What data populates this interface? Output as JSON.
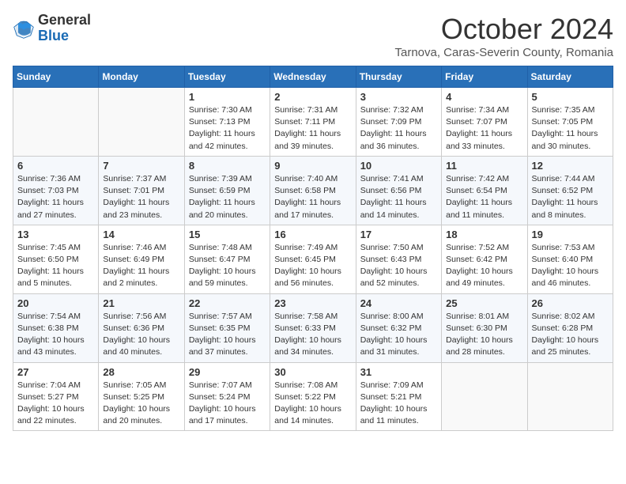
{
  "header": {
    "logo_general": "General",
    "logo_blue": "Blue",
    "month_title": "October 2024",
    "subtitle": "Tarnova, Caras-Severin County, Romania"
  },
  "days_of_week": [
    "Sunday",
    "Monday",
    "Tuesday",
    "Wednesday",
    "Thursday",
    "Friday",
    "Saturday"
  ],
  "weeks": [
    [
      {
        "day": "",
        "info": ""
      },
      {
        "day": "",
        "info": ""
      },
      {
        "day": "1",
        "info": "Sunrise: 7:30 AM\nSunset: 7:13 PM\nDaylight: 11 hours and 42 minutes."
      },
      {
        "day": "2",
        "info": "Sunrise: 7:31 AM\nSunset: 7:11 PM\nDaylight: 11 hours and 39 minutes."
      },
      {
        "day": "3",
        "info": "Sunrise: 7:32 AM\nSunset: 7:09 PM\nDaylight: 11 hours and 36 minutes."
      },
      {
        "day": "4",
        "info": "Sunrise: 7:34 AM\nSunset: 7:07 PM\nDaylight: 11 hours and 33 minutes."
      },
      {
        "day": "5",
        "info": "Sunrise: 7:35 AM\nSunset: 7:05 PM\nDaylight: 11 hours and 30 minutes."
      }
    ],
    [
      {
        "day": "6",
        "info": "Sunrise: 7:36 AM\nSunset: 7:03 PM\nDaylight: 11 hours and 27 minutes."
      },
      {
        "day": "7",
        "info": "Sunrise: 7:37 AM\nSunset: 7:01 PM\nDaylight: 11 hours and 23 minutes."
      },
      {
        "day": "8",
        "info": "Sunrise: 7:39 AM\nSunset: 6:59 PM\nDaylight: 11 hours and 20 minutes."
      },
      {
        "day": "9",
        "info": "Sunrise: 7:40 AM\nSunset: 6:58 PM\nDaylight: 11 hours and 17 minutes."
      },
      {
        "day": "10",
        "info": "Sunrise: 7:41 AM\nSunset: 6:56 PM\nDaylight: 11 hours and 14 minutes."
      },
      {
        "day": "11",
        "info": "Sunrise: 7:42 AM\nSunset: 6:54 PM\nDaylight: 11 hours and 11 minutes."
      },
      {
        "day": "12",
        "info": "Sunrise: 7:44 AM\nSunset: 6:52 PM\nDaylight: 11 hours and 8 minutes."
      }
    ],
    [
      {
        "day": "13",
        "info": "Sunrise: 7:45 AM\nSunset: 6:50 PM\nDaylight: 11 hours and 5 minutes."
      },
      {
        "day": "14",
        "info": "Sunrise: 7:46 AM\nSunset: 6:49 PM\nDaylight: 11 hours and 2 minutes."
      },
      {
        "day": "15",
        "info": "Sunrise: 7:48 AM\nSunset: 6:47 PM\nDaylight: 10 hours and 59 minutes."
      },
      {
        "day": "16",
        "info": "Sunrise: 7:49 AM\nSunset: 6:45 PM\nDaylight: 10 hours and 56 minutes."
      },
      {
        "day": "17",
        "info": "Sunrise: 7:50 AM\nSunset: 6:43 PM\nDaylight: 10 hours and 52 minutes."
      },
      {
        "day": "18",
        "info": "Sunrise: 7:52 AM\nSunset: 6:42 PM\nDaylight: 10 hours and 49 minutes."
      },
      {
        "day": "19",
        "info": "Sunrise: 7:53 AM\nSunset: 6:40 PM\nDaylight: 10 hours and 46 minutes."
      }
    ],
    [
      {
        "day": "20",
        "info": "Sunrise: 7:54 AM\nSunset: 6:38 PM\nDaylight: 10 hours and 43 minutes."
      },
      {
        "day": "21",
        "info": "Sunrise: 7:56 AM\nSunset: 6:36 PM\nDaylight: 10 hours and 40 minutes."
      },
      {
        "day": "22",
        "info": "Sunrise: 7:57 AM\nSunset: 6:35 PM\nDaylight: 10 hours and 37 minutes."
      },
      {
        "day": "23",
        "info": "Sunrise: 7:58 AM\nSunset: 6:33 PM\nDaylight: 10 hours and 34 minutes."
      },
      {
        "day": "24",
        "info": "Sunrise: 8:00 AM\nSunset: 6:32 PM\nDaylight: 10 hours and 31 minutes."
      },
      {
        "day": "25",
        "info": "Sunrise: 8:01 AM\nSunset: 6:30 PM\nDaylight: 10 hours and 28 minutes."
      },
      {
        "day": "26",
        "info": "Sunrise: 8:02 AM\nSunset: 6:28 PM\nDaylight: 10 hours and 25 minutes."
      }
    ],
    [
      {
        "day": "27",
        "info": "Sunrise: 7:04 AM\nSunset: 5:27 PM\nDaylight: 10 hours and 22 minutes."
      },
      {
        "day": "28",
        "info": "Sunrise: 7:05 AM\nSunset: 5:25 PM\nDaylight: 10 hours and 20 minutes."
      },
      {
        "day": "29",
        "info": "Sunrise: 7:07 AM\nSunset: 5:24 PM\nDaylight: 10 hours and 17 minutes."
      },
      {
        "day": "30",
        "info": "Sunrise: 7:08 AM\nSunset: 5:22 PM\nDaylight: 10 hours and 14 minutes."
      },
      {
        "day": "31",
        "info": "Sunrise: 7:09 AM\nSunset: 5:21 PM\nDaylight: 10 hours and 11 minutes."
      },
      {
        "day": "",
        "info": ""
      },
      {
        "day": "",
        "info": ""
      }
    ]
  ]
}
